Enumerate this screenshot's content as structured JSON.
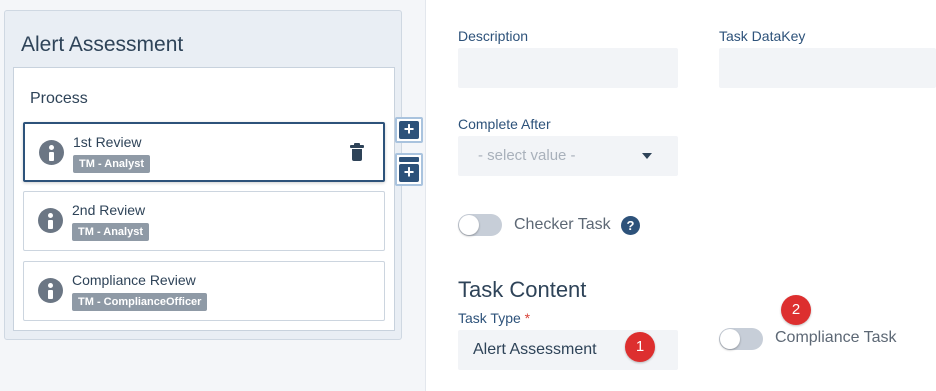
{
  "assessment": {
    "title": "Alert Assessment",
    "process": {
      "title": "Process",
      "steps": [
        {
          "name": "1st Review",
          "role": "TM - Analyst"
        },
        {
          "name": "2nd Review",
          "role": "TM - Analyst"
        },
        {
          "name": "Compliance Review",
          "role": "TM - ComplianceOfficer"
        }
      ]
    },
    "add_button_symbol": "+"
  },
  "form": {
    "description_label": "Description",
    "description_value": "",
    "task_datakey_label": "Task DataKey",
    "task_datakey_value": "",
    "complete_after_label": "Complete After",
    "complete_after_placeholder": "- select value -",
    "checker_task_label": "Checker Task",
    "checker_task_on": false,
    "help_symbol": "?",
    "task_content_title": "Task Content",
    "task_type_label": "Task Type",
    "required_mark": "*",
    "task_type_value": "Alert Assessment",
    "compliance_task_label": "Compliance Task",
    "compliance_task_on": false
  },
  "annotations": [
    {
      "number": "1"
    },
    {
      "number": "2"
    }
  ],
  "colors": {
    "accent": "#2d527a",
    "badge": "#dd2f2f",
    "label": "#2d527a"
  },
  "icons": [
    "info-icon",
    "trash-icon",
    "plus-icon",
    "help-icon",
    "caret-down-icon"
  ]
}
